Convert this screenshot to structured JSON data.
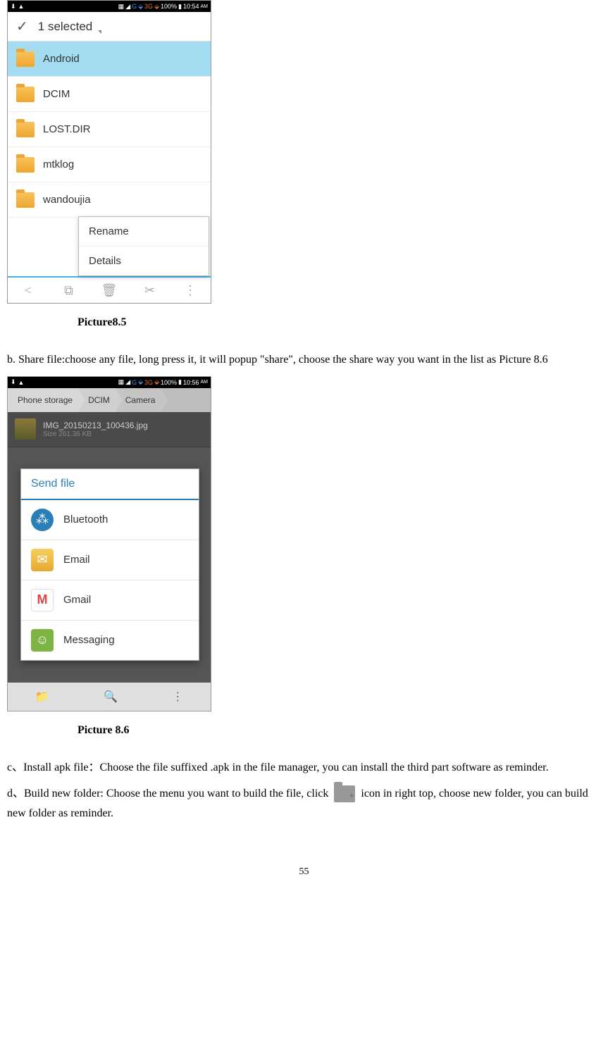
{
  "screenshot1": {
    "statusbar": {
      "time": "10:54",
      "ampm": "AM",
      "battery": "100%",
      "net1": "G",
      "net2": "3G"
    },
    "header_title": "1 selected",
    "folders": [
      "Android",
      "DCIM",
      "LOST.DIR",
      "mtklog",
      "wandoujia"
    ],
    "popup": [
      "Rename",
      "Details"
    ]
  },
  "caption1": "Picture8.5",
  "para_b": "b. Share file:choose any file, long press it, it will popup \"share\", choose the share way you want in the list as Picture 8.6",
  "screenshot2": {
    "statusbar": {
      "time": "10:56",
      "ampm": "AM",
      "battery": "100%",
      "net1": "G",
      "net2": "3G"
    },
    "breadcrumb": [
      "Phone storage",
      "DCIM",
      "Camera"
    ],
    "file": {
      "name": "IMG_20150213_100436.jpg",
      "size": "Size 261.36 KB"
    },
    "dialog_title": "Send file",
    "apps": [
      "Bluetooth",
      "Email",
      "Gmail",
      "Messaging"
    ]
  },
  "caption2": "Picture 8.6",
  "para_c": "c、Install apk file：Choose the file suffixed .apk in the file manager, you can install the third part software as reminder.",
  "para_d_1": "d、Build new folder: Choose the menu you want to build the file, click ",
  "para_d_2": " icon in right top, choose new folder, you can build new folder as reminder.",
  "page_number": "55"
}
